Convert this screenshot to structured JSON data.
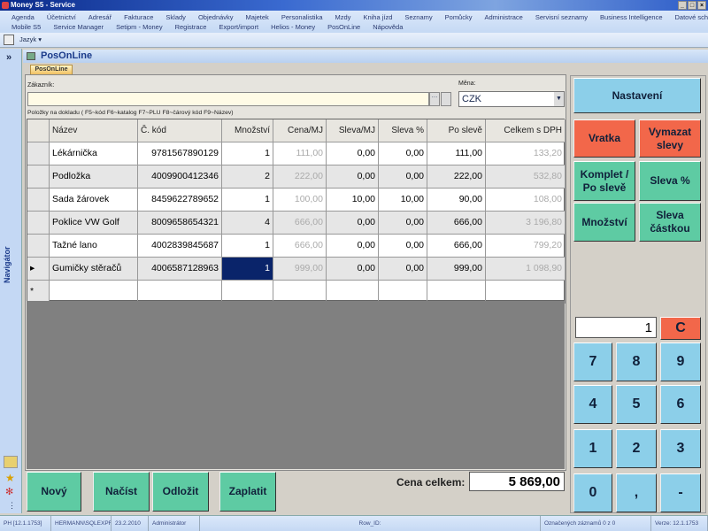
{
  "window": {
    "title": "Money S5 - Service",
    "controls": [
      "_",
      "□",
      "×"
    ]
  },
  "menu": {
    "row1": [
      "Agenda",
      "Účetnictví",
      "Adresář",
      "Fakturace",
      "Sklady",
      "Objednávky",
      "Majetek",
      "Personalistika",
      "Mzdy",
      "Kniha jízd",
      "Seznamy",
      "Pomůcky",
      "Administrace",
      "Servisní seznamy",
      "Business Intelligence",
      "Datové schránky"
    ],
    "row2": [
      "Mobile S5",
      "Service Manager",
      "Setipm - Money",
      "Registrace",
      "Export/import",
      "Helios - Money",
      "PosOnLine",
      "Nápověda"
    ]
  },
  "toolbar": {
    "language": "Jazyk"
  },
  "navigator": {
    "label": "Navigátor",
    "expand": "»"
  },
  "module": {
    "title": "PosOnLine",
    "tab": "PosOnLine"
  },
  "form": {
    "customer_label": "Zákazník:",
    "customer_value": "",
    "currency_label": "Měna:",
    "currency_value": "CZK",
    "items_hint": "Položky na dokladu ( F5~kód  F6~katalog  F7~PLU  F8~čárový kód  F9~Název)"
  },
  "grid": {
    "headers": [
      "Název",
      "Č. kód",
      "Množství",
      "Cena/MJ",
      "Sleva/MJ",
      "Sleva %",
      "Po slevě",
      "Celkem s DPH"
    ],
    "rows": [
      [
        "Lékárnička",
        "9781567890129",
        "1",
        "111,00",
        "0,00",
        "0,00",
        "111,00",
        "133,20"
      ],
      [
        "Podložka",
        "4009900412346",
        "2",
        "222,00",
        "0,00",
        "0,00",
        "222,00",
        "532,80"
      ],
      [
        "Sada žárovek",
        "8459622789652",
        "1",
        "100,00",
        "10,00",
        "10,00",
        "90,00",
        "108,00"
      ],
      [
        "Poklice VW Golf",
        "8009658654321",
        "4",
        "666,00",
        "0,00",
        "0,00",
        "666,00",
        "3 196,80"
      ],
      [
        "Tažné lano",
        "4002839845687",
        "1",
        "666,00",
        "0,00",
        "0,00",
        "666,00",
        "799,20"
      ],
      [
        "Gumičky stěračů",
        "4006587128963",
        "1",
        "999,00",
        "0,00",
        "0,00",
        "999,00",
        "1 098,90"
      ]
    ],
    "new_row_marker": "*",
    "current_marker": "▸"
  },
  "actions": {
    "new": "Nový",
    "load": "Načíst",
    "postpone": "Odložit",
    "pay": "Zaplatit"
  },
  "total": {
    "label": "Cena celkem:",
    "value": "5 869,00"
  },
  "side": {
    "settings": "Nastavení",
    "return": "Vratka",
    "clear_discounts": "Vymazat slevy",
    "bundle": "Komplet / Po slevě",
    "discount_pct": "Sleva %",
    "quantity": "Množství",
    "discount_amount": "Sleva částkou"
  },
  "keypad": {
    "display": "1",
    "clear": "C",
    "keys": [
      "7",
      "8",
      "9",
      "4",
      "5",
      "6",
      "1",
      "2",
      "3",
      "0",
      ",",
      "-"
    ]
  },
  "status": [
    "PH [12.1.1753]",
    "HERMANN\\SQLEXPRESS",
    "23.2.2010",
    "Administrátor",
    "Row_ID:",
    "Označených záznamů 0 z 0",
    "Verze: 12.1.1753"
  ]
}
